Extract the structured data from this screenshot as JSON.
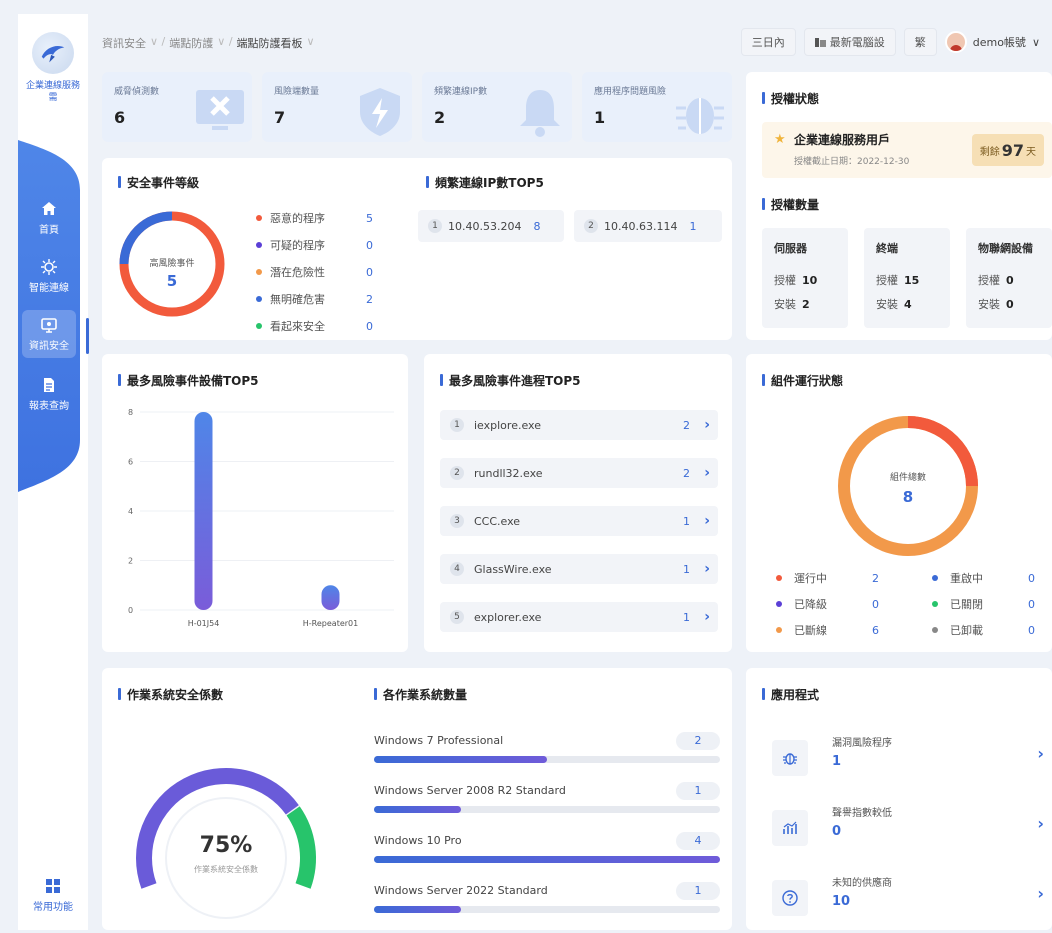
{
  "sidebar": {
    "org_name": "企業連線服務需",
    "items": [
      {
        "label": "首頁",
        "icon": "home-icon"
      },
      {
        "label": "智能連線",
        "icon": "network-icon"
      },
      {
        "label": "資訊安全",
        "icon": "security-icon"
      },
      {
        "label": "報表查詢",
        "icon": "report-icon"
      }
    ],
    "active_index": 2,
    "common_label": "常用功能"
  },
  "breadcrumb": [
    "資訊安全",
    "端點防護",
    "端點防護看板"
  ],
  "topbar": {
    "range_label": "三日內",
    "refresh_label": "最新電腦設",
    "lang_label": "繁",
    "user_label": "demo帳號"
  },
  "stats": [
    {
      "label": "威脅偵測數",
      "value": "6"
    },
    {
      "label": "風險端數量",
      "value": "7"
    },
    {
      "label": "頻繁連線IP數",
      "value": "2"
    },
    {
      "label": "應用程序問題風險",
      "value": "1"
    }
  ],
  "event_level": {
    "title": "安全事件等級",
    "center_label": "高風險事件",
    "center_value": "5",
    "legend": [
      {
        "label": "惡意的程序",
        "value": "5",
        "color": "#f25a3c"
      },
      {
        "label": "可疑的程序",
        "value": "0",
        "color": "#5b3fd6"
      },
      {
        "label": "潛在危險性",
        "value": "0",
        "color": "#f2994a"
      },
      {
        "label": "無明確危害",
        "value": "2",
        "color": "#3a6ad6"
      },
      {
        "label": "看起來安全",
        "value": "0",
        "color": "#27c46b"
      }
    ]
  },
  "ip_top5": {
    "title": "頻繁連線IP數TOP5",
    "items": [
      {
        "idx": "1",
        "ip": "10.40.53.204",
        "count": "8"
      },
      {
        "idx": "2",
        "ip": "10.40.63.114",
        "count": "1"
      }
    ]
  },
  "device_top5": {
    "title": "最多風險事件設備TOP5",
    "chart_data": {
      "type": "bar",
      "categories": [
        "H-01J54",
        "H-Repeater01"
      ],
      "values": [
        8,
        1
      ],
      "ylim": [
        0,
        8
      ],
      "yticks": [
        0,
        2,
        4,
        6,
        8
      ]
    }
  },
  "process_top5": {
    "title": "最多風險事件進程TOP5",
    "items": [
      {
        "idx": "1",
        "name": "iexplore.exe",
        "count": "2"
      },
      {
        "idx": "2",
        "name": "rundll32.exe",
        "count": "2"
      },
      {
        "idx": "3",
        "name": "CCC.exe",
        "count": "1"
      },
      {
        "idx": "4",
        "name": "GlassWire.exe",
        "count": "1"
      },
      {
        "idx": "5",
        "name": "explorer.exe",
        "count": "1"
      }
    ]
  },
  "license": {
    "status_title": "授權狀態",
    "tenant": "企業連線服務用戶",
    "expiry": "授權截止日期：2022-12-30",
    "days_prefix": "剩餘",
    "days_value": "97",
    "days_suffix": "天",
    "qty_title": "授權數量",
    "boxes": [
      {
        "name": "伺服器",
        "auth_label": "授權",
        "auth": "10",
        "inst_label": "安裝",
        "inst": "2"
      },
      {
        "name": "終端",
        "auth_label": "授權",
        "auth": "15",
        "inst_label": "安裝",
        "inst": "4"
      },
      {
        "name": "物聯網設備",
        "auth_label": "授權",
        "auth": "0",
        "inst_label": "安裝",
        "inst": "0"
      }
    ]
  },
  "components": {
    "title": "組件運行狀態",
    "center_label": "組件總數",
    "center_value": "8",
    "legend": [
      {
        "label": "運行中",
        "value": "2",
        "color": "#f25a3c"
      },
      {
        "label": "重啟中",
        "value": "0",
        "color": "#3a6ad6"
      },
      {
        "label": "已降級",
        "value": "0",
        "color": "#5b3fd6"
      },
      {
        "label": "已關閉",
        "value": "0",
        "color": "#27c46b"
      },
      {
        "label": "已斷線",
        "value": "6",
        "color": "#f2994a"
      },
      {
        "label": "已卸載",
        "value": "0",
        "color": "#888888"
      }
    ]
  },
  "os_security": {
    "title": "作業系統安全係數",
    "value": "75%",
    "fraction": 0.75,
    "caption": "作業系統安全係數"
  },
  "os_count": {
    "title": "各作業系統數量",
    "max": 4,
    "items": [
      {
        "name": "Windows 7 Professional",
        "count": "2",
        "value": 2
      },
      {
        "name": "Windows Server 2008 R2 Standard",
        "count": "1",
        "value": 1
      },
      {
        "name": "Windows 10 Pro",
        "count": "4",
        "value": 4
      },
      {
        "name": "Windows Server 2022 Standard",
        "count": "1",
        "value": 1
      }
    ]
  },
  "apps": {
    "title": "應用程式",
    "items": [
      {
        "label": "漏洞風險程序",
        "value": "1",
        "icon": "bug-icon"
      },
      {
        "label": "聲譽指數較低",
        "value": "0",
        "icon": "chart-icon"
      },
      {
        "label": "未知的供應商",
        "value": "10",
        "icon": "question-icon"
      }
    ]
  },
  "colors": {
    "accent": "#3a6ad6",
    "danger": "#f25a3c",
    "warning": "#f2994a",
    "gauge_green": "#27c46b"
  }
}
